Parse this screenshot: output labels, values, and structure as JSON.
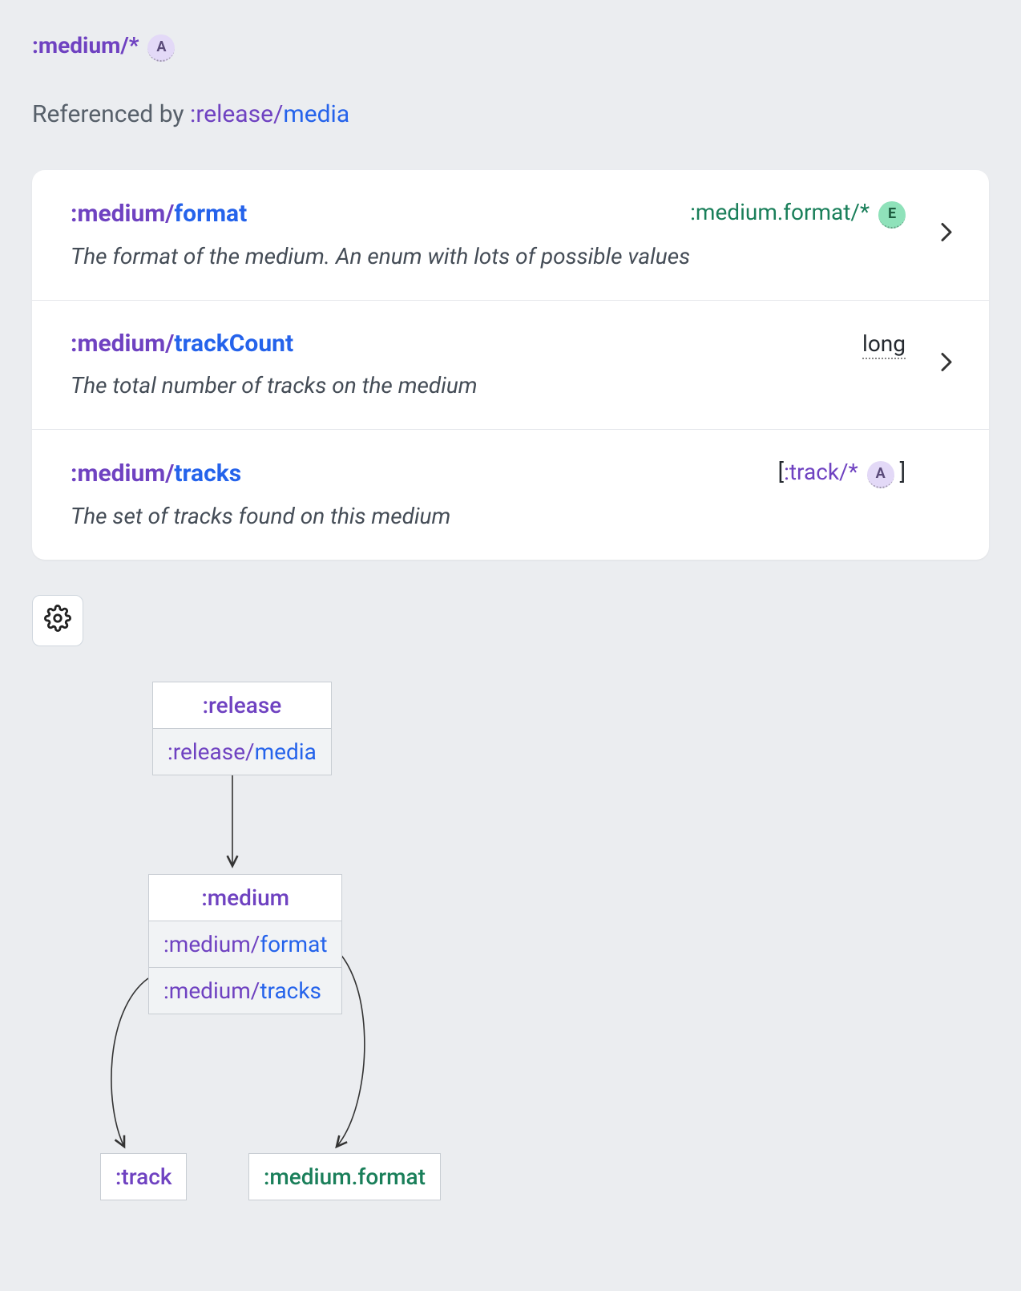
{
  "header": {
    "ns": ":medium",
    "slash": "/",
    "star": "*",
    "badge": "A"
  },
  "referenced": {
    "label": "Referenced by ",
    "ns": ":release",
    "slash": "/",
    "attr": "media"
  },
  "rows": [
    {
      "ns": ":medium",
      "slash": "/",
      "attr": "format",
      "type_ns": ":medium.format",
      "type_slash": "/",
      "type_star": "*",
      "type_badge": "E",
      "type_raw": null,
      "bracket_open": null,
      "bracket_close": null,
      "desc": "The format of the medium. An enum with lots of possible values"
    },
    {
      "ns": ":medium",
      "slash": "/",
      "attr": "trackCount",
      "type_ns": null,
      "type_slash": null,
      "type_star": null,
      "type_badge": null,
      "type_raw": "long",
      "bracket_open": null,
      "bracket_close": null,
      "desc": "The total number of tracks on the medium"
    },
    {
      "ns": ":medium",
      "slash": "/",
      "attr": "tracks",
      "type_ns": ":track",
      "type_slash": "/",
      "type_star": "*",
      "type_badge": "A",
      "type_raw": null,
      "bracket_open": "[",
      "bracket_close": " ]",
      "desc": "The set of tracks found on this medium"
    }
  ],
  "diagram": {
    "release": {
      "head": ":release",
      "sub_ns": ":release",
      "sub_slash": "/",
      "sub_attr": "media"
    },
    "medium": {
      "head": ":medium",
      "s1_ns": ":medium",
      "s1_slash": "/",
      "s1_attr": "format",
      "s2_ns": ":medium",
      "s2_slash": "/",
      "s2_attr": "tracks"
    },
    "track": {
      "head": ":track"
    },
    "medfmt": {
      "head": ":medium.format"
    }
  }
}
